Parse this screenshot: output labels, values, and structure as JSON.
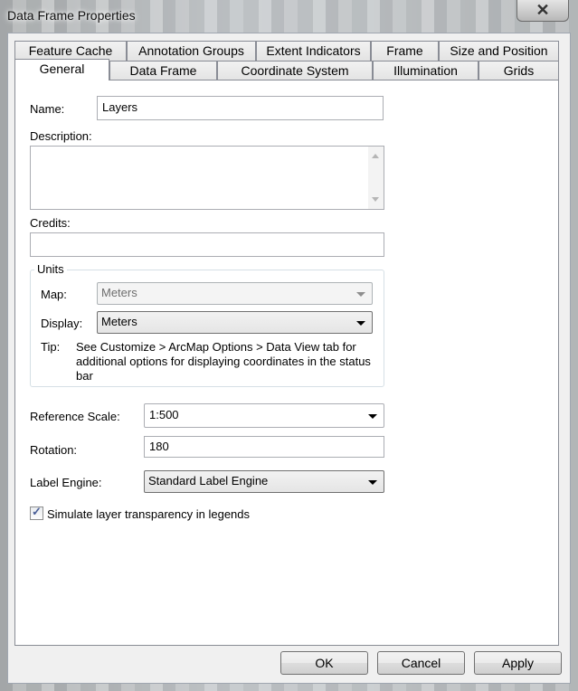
{
  "window": {
    "title": "Data Frame Properties",
    "close_glyph": "✕"
  },
  "tabs_row1": [
    "Feature Cache",
    "Annotation Groups",
    "Extent Indicators",
    "Frame",
    "Size and Position"
  ],
  "tabs_row2": [
    "General",
    "Data Frame",
    "Coordinate System",
    "Illumination",
    "Grids"
  ],
  "active_tab": "General",
  "general": {
    "name_label": "Name:",
    "name_value": "Layers",
    "description_label": "Description:",
    "description_value": "",
    "credits_label": "Credits:",
    "credits_value": "",
    "units_title": "Units",
    "map_label": "Map:",
    "map_value": "Meters",
    "display_label": "Display:",
    "display_value": "Meters",
    "tip_label": "Tip:",
    "tip_text": "See Customize > ArcMap Options > Data View tab for additional options for displaying coordinates in the status bar",
    "reference_scale_label": "Reference Scale:",
    "reference_scale_value": "1:500",
    "rotation_label": "Rotation:",
    "rotation_value": "180",
    "label_engine_label": "Label Engine:",
    "label_engine_value": "Standard Label Engine",
    "simulate_label": "Simulate layer transparency in legends",
    "simulate_checked": true
  },
  "buttons": {
    "ok": "OK",
    "cancel": "Cancel",
    "apply": "Apply"
  },
  "colors": {
    "annotation": "#ff00e6",
    "check": "#4a5f97"
  }
}
